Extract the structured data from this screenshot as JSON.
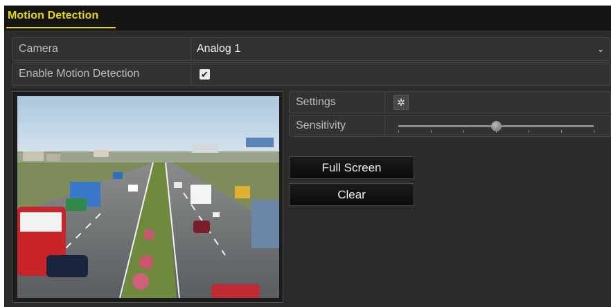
{
  "header": {
    "title": "Motion Detection"
  },
  "camera": {
    "label": "Camera",
    "value": "Analog 1",
    "icon": "chevron-down-icon"
  },
  "enable": {
    "label": "Enable Motion Detection",
    "checked": true,
    "check_glyph": "✔"
  },
  "settings": {
    "label": "Settings",
    "icon": "gear-icon",
    "icon_glyph": "✲"
  },
  "sensitivity": {
    "label": "Sensitivity",
    "level_fraction": 0.5,
    "ticks": 7
  },
  "buttons": {
    "full_screen": "Full Screen",
    "clear": "Clear"
  },
  "colors": {
    "title_accent": "#e8d800",
    "panel_bg": "#2b2b2b",
    "header_bg": "#141414"
  }
}
